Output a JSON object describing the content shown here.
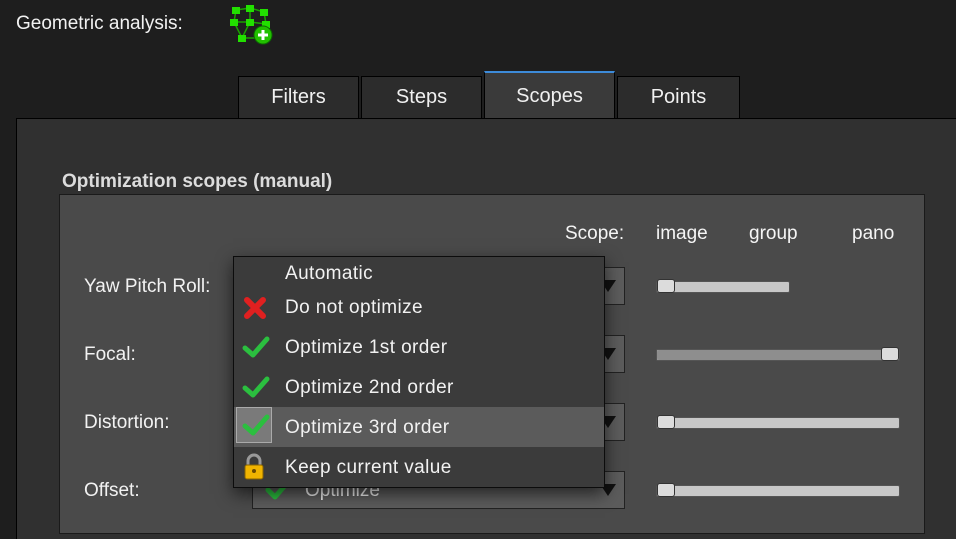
{
  "header": {
    "label": "Geometric analysis:",
    "icon": "network-add-icon"
  },
  "tabs": [
    {
      "label": "Filters",
      "active": false
    },
    {
      "label": "Steps",
      "active": false
    },
    {
      "label": "Scopes",
      "active": true
    },
    {
      "label": "Points",
      "active": false
    }
  ],
  "section": {
    "title": "Optimization scopes (manual)"
  },
  "scope_header": {
    "label": "Scope:",
    "image": "image",
    "group": "group",
    "pano": "pano"
  },
  "rows": [
    {
      "label": "Yaw Pitch Roll:",
      "value": "",
      "slider_level": 0.0
    },
    {
      "label": "Focal:",
      "value": "",
      "slider_level": 1.0
    },
    {
      "label": "Distortion:",
      "value": "",
      "slider_level": 0.0
    },
    {
      "label": "Offset:",
      "value": "Optimize",
      "slider_level": 0.0
    }
  ],
  "dropdown": {
    "items": [
      {
        "label": "Automatic",
        "icon": ""
      },
      {
        "label": "Do not optimize",
        "icon": "red-x-icon"
      },
      {
        "label": "Optimize 1st order",
        "icon": "green-check-icon"
      },
      {
        "label": "Optimize 2nd order",
        "icon": "green-check-icon"
      },
      {
        "label": "Optimize 3rd order",
        "icon": "green-check-icon",
        "highlighted": true
      },
      {
        "label": "Keep current value",
        "icon": "padlock-icon"
      }
    ]
  },
  "colors": {
    "accent": "#3d8bd9",
    "check": "#2bbf3f",
    "cross": "#e02020",
    "lock": "#f0b400",
    "icon_green": "#22e000"
  }
}
